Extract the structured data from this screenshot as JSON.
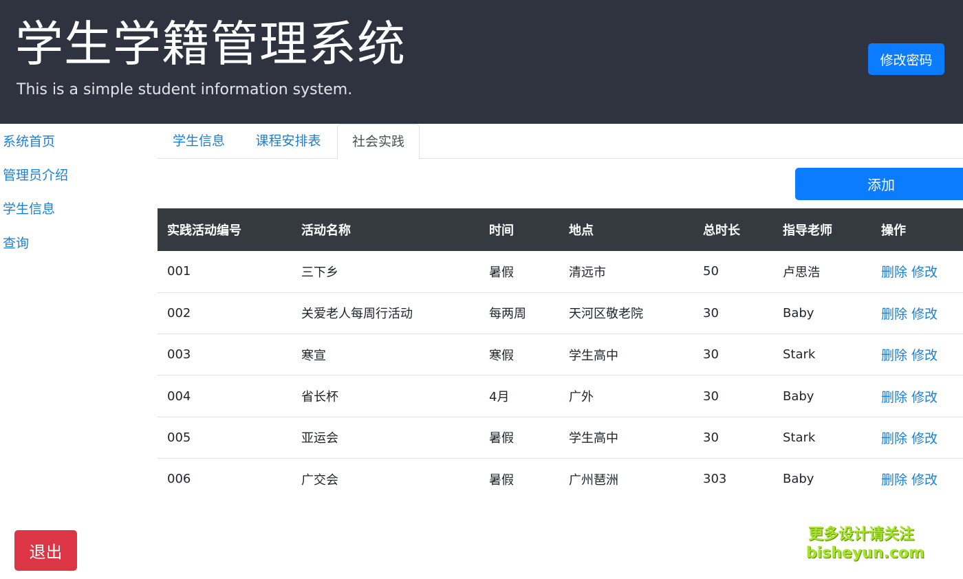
{
  "header": {
    "title": "学生学籍管理系统",
    "subtitle": "This is a simple student information system.",
    "change_password_label": "修改密码"
  },
  "sidebar": {
    "items": [
      {
        "label": "系统首页"
      },
      {
        "label": "管理员介绍"
      },
      {
        "label": "学生信息"
      },
      {
        "label": "查询"
      }
    ]
  },
  "tabs": [
    {
      "label": "学生信息",
      "active": false
    },
    {
      "label": "课程安排表",
      "active": false
    },
    {
      "label": "社会实践",
      "active": true
    }
  ],
  "toolbar": {
    "add_label": "添加"
  },
  "table": {
    "columns": [
      "实践活动编号",
      "活动名称",
      "时间",
      "地点",
      "总时长",
      "指导老师",
      "操作"
    ],
    "rows": [
      {
        "id": "001",
        "name": "三下乡",
        "time": "暑假",
        "place": "清远市",
        "duration": "50",
        "teacher": "卢思浩"
      },
      {
        "id": "002",
        "name": "关爱老人每周行活动",
        "time": "每两周",
        "place": "天河区敬老院",
        "duration": "30",
        "teacher": "Baby"
      },
      {
        "id": "003",
        "name": "寒宣",
        "time": "寒假",
        "place": "学生高中",
        "duration": "30",
        "teacher": "Stark"
      },
      {
        "id": "004",
        "name": "省长杯",
        "time": "4月",
        "place": "广外",
        "duration": "30",
        "teacher": "Baby"
      },
      {
        "id": "005",
        "name": "亚运会",
        "time": "暑假",
        "place": "学生高中",
        "duration": "30",
        "teacher": "Stark"
      },
      {
        "id": "006",
        "name": "广交会",
        "time": "暑假",
        "place": "广州琶洲",
        "duration": "303",
        "teacher": "Baby"
      }
    ],
    "delete_label": "删除",
    "edit_label": "修改"
  },
  "footer": {
    "logout_label": "退出"
  },
  "watermark": {
    "line1": "更多设计请关注",
    "line2": "bisheyun.com"
  },
  "colors": {
    "header_bg": "#2f3340",
    "primary": "#0b7bff",
    "danger": "#dc3545",
    "link": "#1a7fd6",
    "table_head_bg": "#343a40"
  }
}
